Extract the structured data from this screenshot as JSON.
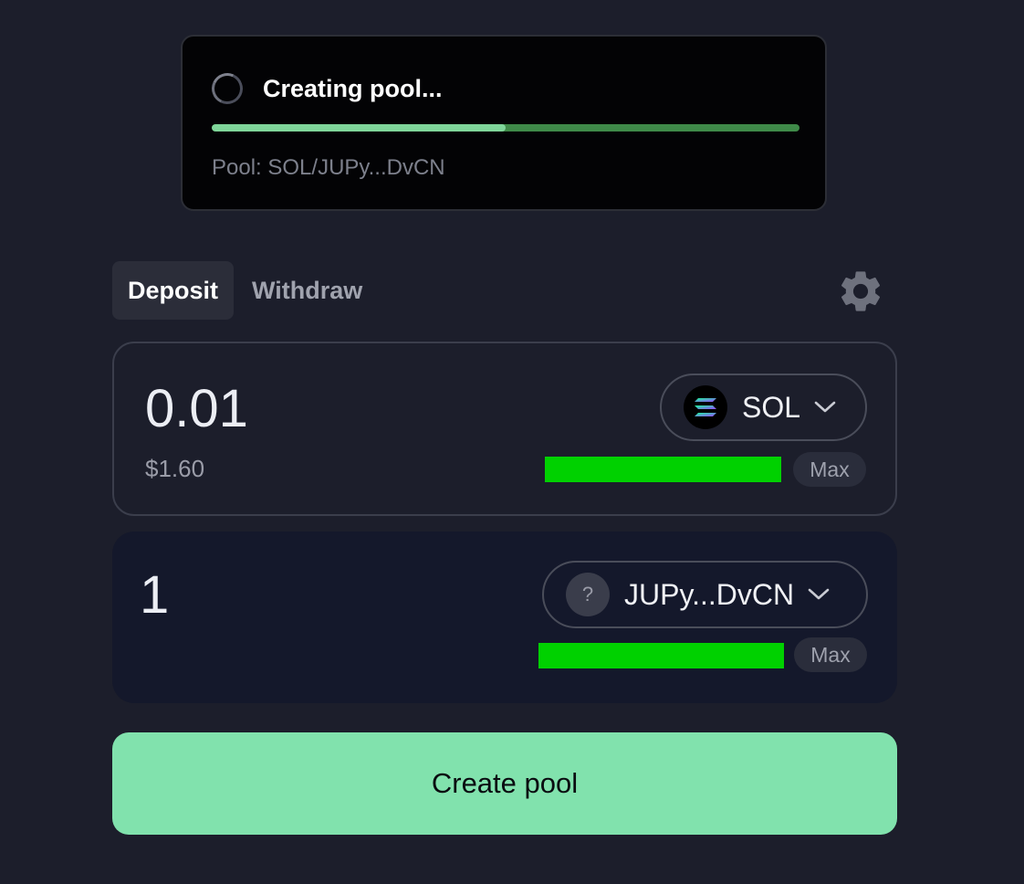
{
  "toast": {
    "title": "Creating pool...",
    "subtitle": "Pool: SOL/JUPy...DvCN",
    "progress": 0.5,
    "colors": {
      "progress_fill": "#7fd69a",
      "progress_track": "#3f8a49"
    }
  },
  "tabs": [
    {
      "label": "Deposit",
      "active": true
    },
    {
      "label": "Withdraw",
      "active": false
    }
  ],
  "settings": {
    "icon": "gear-icon"
  },
  "token_a": {
    "amount": "0.01",
    "usd_value": "$1.60",
    "symbol": "SOL",
    "icon": "solana-logo-icon",
    "max_label": "Max"
  },
  "token_b": {
    "amount": "1",
    "symbol": "JUPy...DvCN",
    "icon": "question-mark-icon",
    "icon_glyph": "?",
    "max_label": "Max"
  },
  "create_button": {
    "label": "Create pool"
  },
  "colors": {
    "background": "#1c1e2b",
    "accent": "#81e2ad",
    "redaction": "#00d100"
  }
}
